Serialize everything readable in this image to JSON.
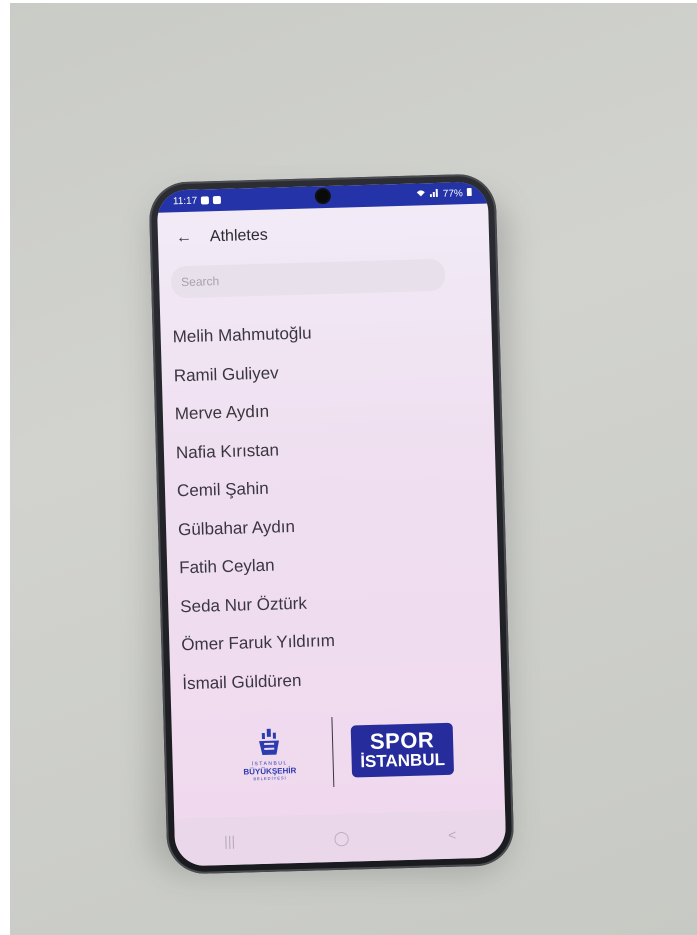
{
  "status_bar": {
    "time": "11:17",
    "battery": "77%"
  },
  "app_bar": {
    "title": "Athletes"
  },
  "search": {
    "placeholder": "Search"
  },
  "athletes": [
    "Melih Mahmutoğlu",
    "Ramil Guliyev",
    "Merve Aydın",
    "Nafia Kırıstan",
    "Cemil Şahin",
    "Gülbahar Aydın",
    "Fatih Ceylan",
    "Seda Nur Öztürk",
    "Ömer Faruk Yıldırım",
    "İsmail Güldüren"
  ],
  "logos": {
    "ibb_city": "İSTANBUL",
    "ibb_main": "BÜYÜKŞEHİR",
    "ibb_sub": "BELEDİYESİ",
    "spor_line1": "SPOR",
    "spor_line2": "İSTANBUL"
  },
  "nav_bar": {
    "recents": "|||",
    "home": "◯",
    "back": "<"
  },
  "colors": {
    "status_bar": "#2433a8",
    "screen_bg": "#f0e2f1",
    "brand_blue": "#262c9c"
  },
  "icons": [
    "arrow-left-icon",
    "wifi-icon",
    "signal-icon",
    "battery-icon",
    "ibb-emblem-icon"
  ]
}
